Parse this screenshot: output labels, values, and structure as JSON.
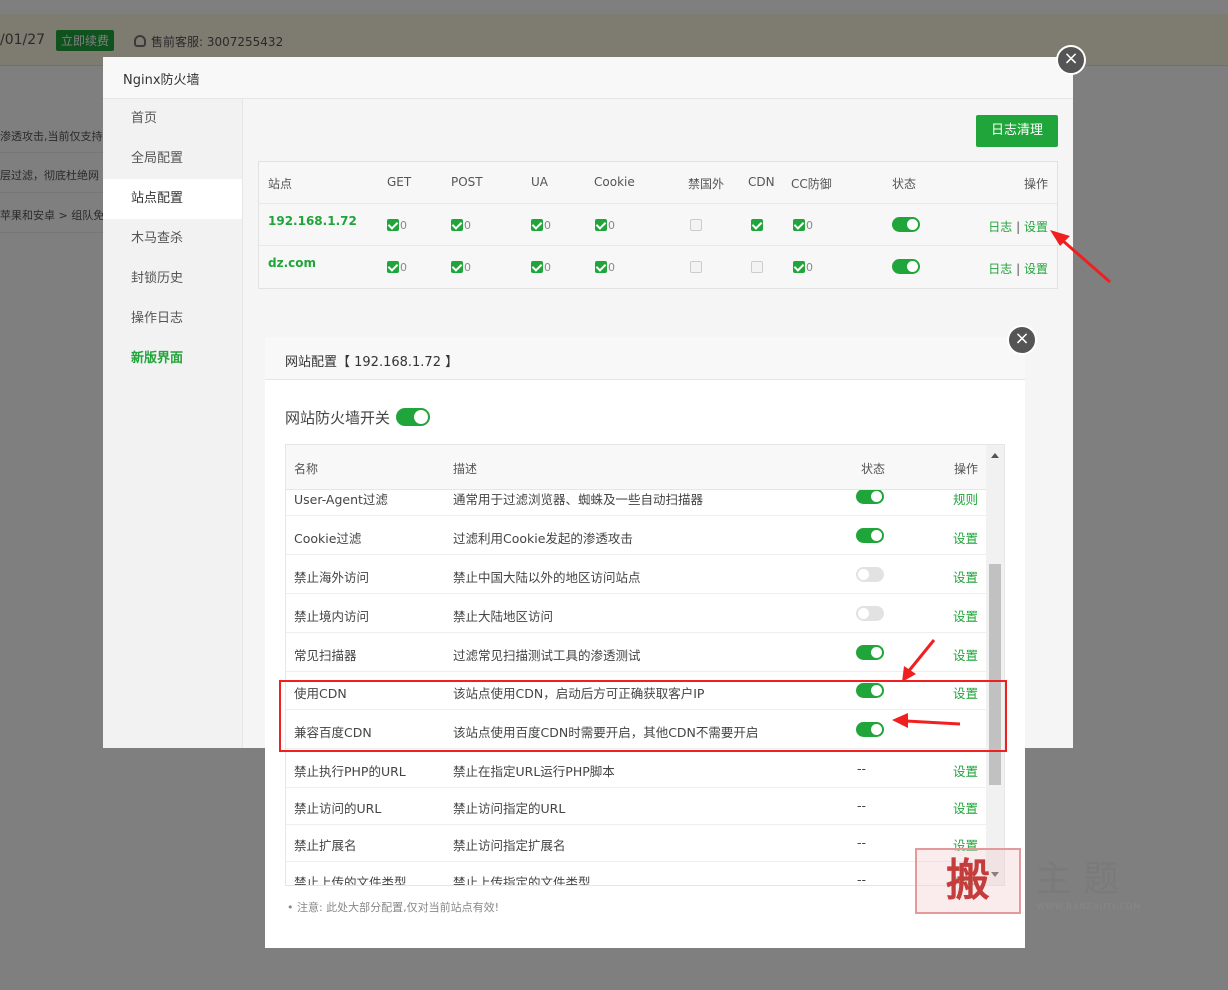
{
  "background": {
    "date_fragment": "/01/27",
    "renew_button": "立即续费",
    "support_label": "售前客服: 3007255432",
    "side_texts": [
      "渗透攻击,当前仅支持",
      "层过滤，彻底杜绝网",
      "苹果和安卓 > 组队免"
    ]
  },
  "firewall": {
    "title": "Nginx防火墙",
    "sidebar": [
      "首页",
      "全局配置",
      "站点配置",
      "木马查杀",
      "封锁历史",
      "操作日志",
      "新版界面"
    ],
    "clear_log_button": "日志清理",
    "columns": [
      "站点",
      "GET",
      "POST",
      "UA",
      "Cookie",
      "禁国外",
      "CDN",
      "CC防御",
      "状态",
      "操作"
    ],
    "sites": [
      {
        "name": "192.168.1.72",
        "get": "0",
        "post": "0",
        "ua": "0",
        "cookie": "0",
        "cc": "0",
        "log": "日志",
        "sep": "|",
        "settings": "设置"
      },
      {
        "name": "dz.com",
        "get": "0",
        "post": "0",
        "ua": "0",
        "cookie": "0",
        "cc": "0",
        "log": "日志",
        "sep": "|",
        "settings": "设置"
      }
    ]
  },
  "dialog": {
    "title": "网站配置【 192.168.1.72 】",
    "site_firewall_switch": "网站防火墙开关",
    "columns": [
      "名称",
      "描述",
      "状态",
      "操作"
    ],
    "rows": [
      {
        "name": "User-Agent过滤",
        "desc": "通常用于过滤浏览器、蜘蛛及一些自动扫描器",
        "state": "on",
        "op": "规则"
      },
      {
        "name": "Cookie过滤",
        "desc": "过滤利用Cookie发起的渗透攻击",
        "state": "on",
        "op": "设置"
      },
      {
        "name": "禁止海外访问",
        "desc": "禁止中国大陆以外的地区访问站点",
        "state": "off",
        "op": "设置"
      },
      {
        "name": "禁止境内访问",
        "desc": "禁止大陆地区访问",
        "state": "off",
        "op": "设置"
      },
      {
        "name": "常见扫描器",
        "desc": "过滤常见扫描测试工具的渗透测试",
        "state": "on",
        "op": "设置"
      },
      {
        "name": "使用CDN",
        "desc": "该站点使用CDN，启动后方可正确获取客户IP",
        "state": "on",
        "op": "设置"
      },
      {
        "name": "兼容百度CDN",
        "desc": "该站点使用百度CDN时需要开启，其他CDN不需要开启",
        "state": "on",
        "op": ""
      },
      {
        "name": "禁止执行PHP的URL",
        "desc": "禁止在指定URL运行PHP脚本",
        "state": "--",
        "op": "设置"
      },
      {
        "name": "禁止访问的URL",
        "desc": "禁止访问指定的URL",
        "state": "--",
        "op": "设置"
      },
      {
        "name": "禁止扩展名",
        "desc": "禁止访问指定扩展名",
        "state": "--",
        "op": "设置"
      },
      {
        "name": "禁止上传的文件类型",
        "desc": "禁止上传指定的文件类型",
        "state": "--",
        "op": "设置"
      }
    ],
    "note": "• 注意: 此处大部分配置,仅对当前站点有效!"
  },
  "watermark": {
    "logo_char": "搬",
    "text": "主题",
    "url": "WWW.BANZHUTI.COM"
  },
  "colors": {
    "accent": "#20a53a",
    "annotation": "#f02020"
  }
}
